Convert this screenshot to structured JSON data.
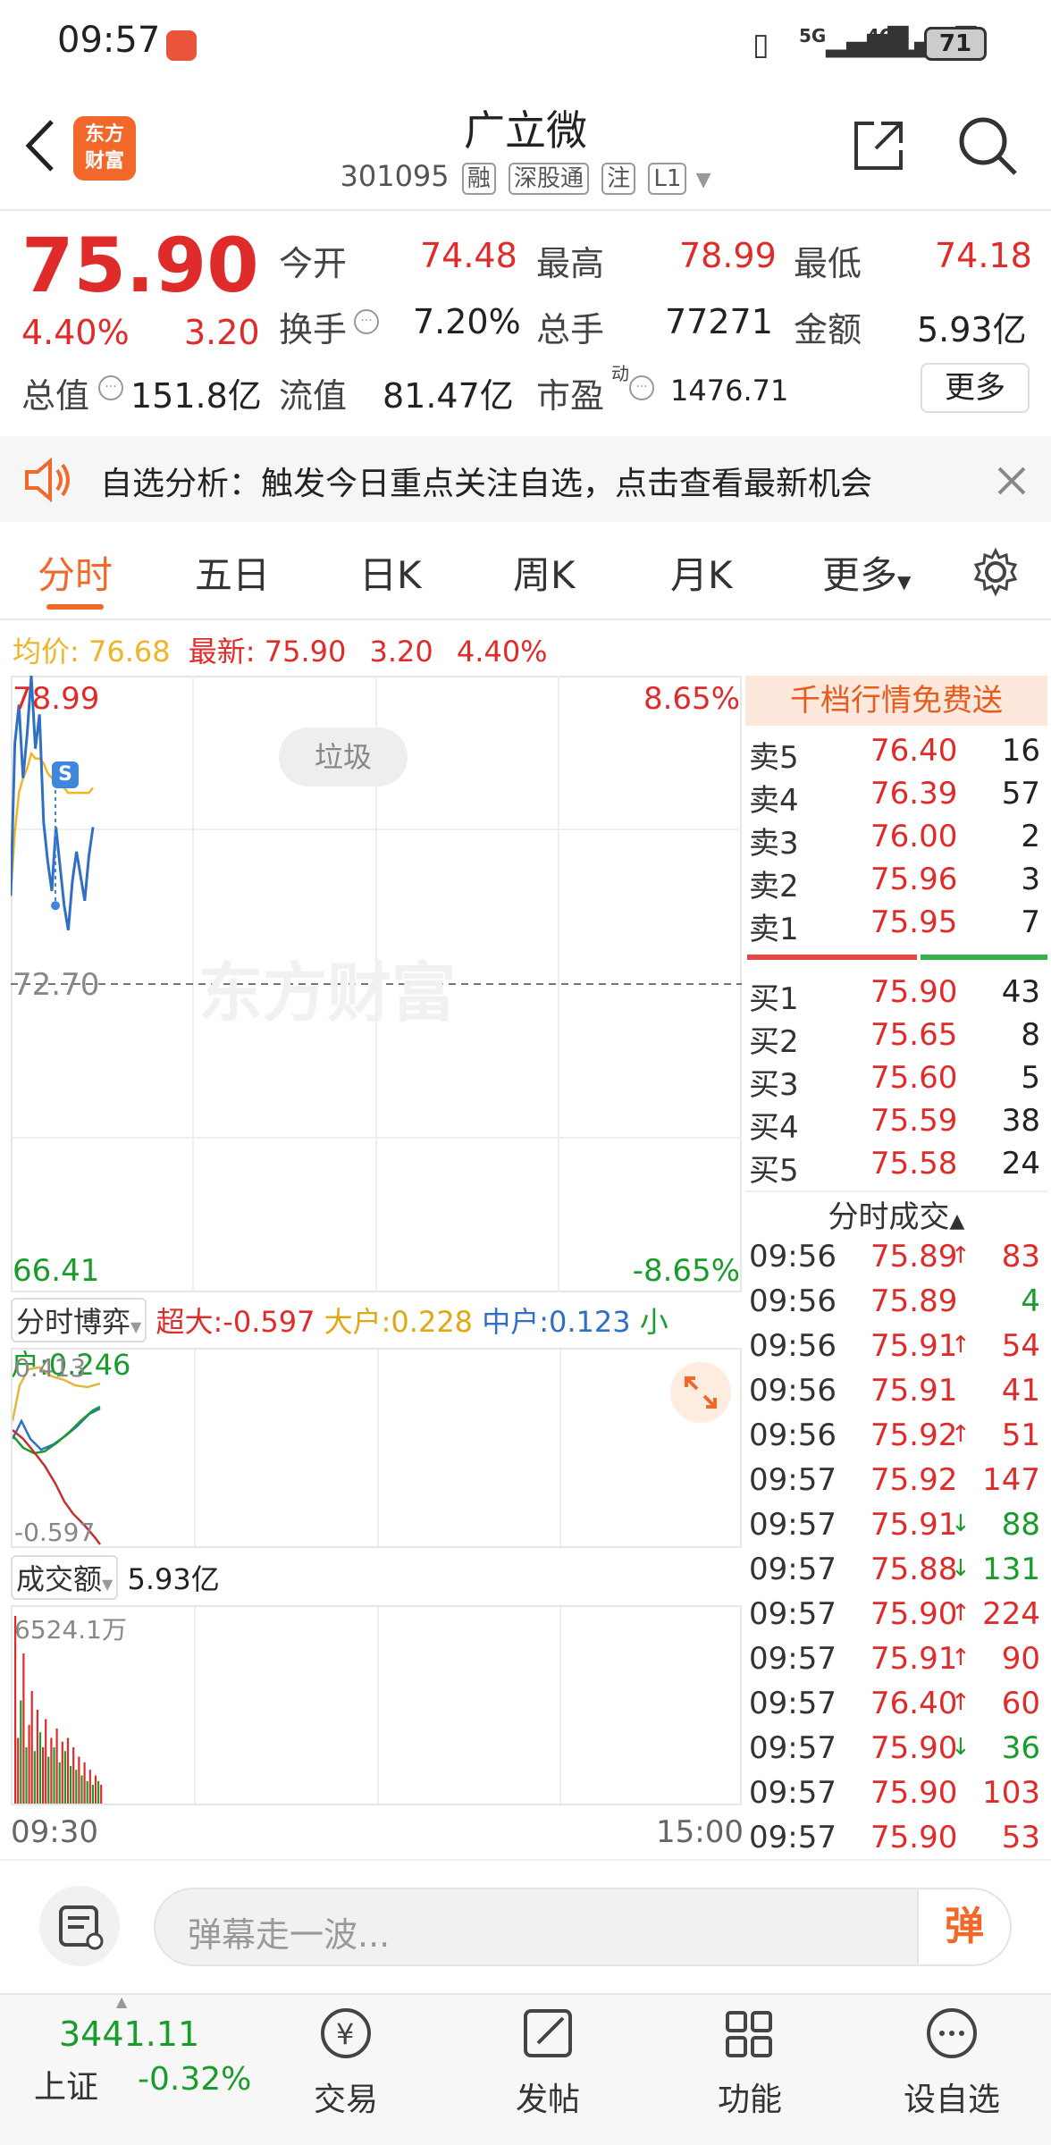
{
  "status": {
    "time": "09:57",
    "battery": "71",
    "net1": "5G",
    "net2": "4G"
  },
  "header": {
    "logo_line1": "东方",
    "logo_line2": "财富",
    "title": "广立微",
    "code": "301095",
    "tags": [
      "融",
      "深股通",
      "注",
      "L1"
    ]
  },
  "quote": {
    "price": "75.90",
    "change_pct": "4.40%",
    "change": "3.20",
    "open_label": "今开",
    "open": "74.48",
    "high_label": "最高",
    "high": "78.99",
    "low_label": "最低",
    "low": "74.18",
    "turnover_label": "换手",
    "turnover": "7.20%",
    "volume_label": "总手",
    "volume": "77271",
    "amount_label": "金额",
    "amount": "5.93亿",
    "mktcap_label": "总值",
    "mktcap": "151.8亿",
    "float_label": "流值",
    "float": "81.47亿",
    "pe_label": "市盈",
    "pe_sup": "动",
    "pe": "1476.71",
    "more_button": "更多"
  },
  "banner": {
    "text": "自选分析：触发今日重点关注自选，点击查看最新机会"
  },
  "tabs": [
    "分时",
    "五日",
    "日K",
    "周K",
    "月K",
    "更多"
  ],
  "info_line": {
    "avg_label": "均价:",
    "avg": "76.68",
    "latest_label": "最新:",
    "latest": "75.90",
    "change": "3.20",
    "change_pct": "4.40%"
  },
  "chart": {
    "max_price": "78.99",
    "max_pct": "8.65%",
    "prev_close": "72.70",
    "min_price": "66.41",
    "min_pct": "-8.65%",
    "tag_label": "垃圾",
    "watermark": "东方财富",
    "s_marker": "S",
    "time_start": "09:30",
    "time_end": "15:00"
  },
  "chart_data": {
    "type": "line",
    "ylim": [
      66.41,
      78.99
    ],
    "prev_close": 72.7,
    "price_series": [
      74.5,
      77.6,
      78.4,
      76.9,
      77.8,
      78.99,
      77.5,
      78.2,
      76.0,
      75.2,
      74.6,
      75.9,
      75.1,
      74.3,
      73.8,
      74.8,
      75.4,
      74.9,
      74.4,
      75.3,
      75.9
    ],
    "avg_series": [
      74.5,
      75.8,
      76.6,
      76.9,
      77.1,
      77.4,
      77.3,
      77.3,
      77.2,
      77.0,
      76.9,
      76.9,
      76.8,
      76.7,
      76.6,
      76.6,
      76.6,
      76.6,
      76.6,
      76.6,
      76.7
    ]
  },
  "game": {
    "selector": "分时博弈",
    "super_label": "超大:",
    "super": "-0.597",
    "big_label": "大户:",
    "big": "0.228",
    "mid_label": "中户:",
    "mid": "0.123",
    "small_label": "小户:",
    "small": "0.246",
    "top": "0.413",
    "bottom": "-0.597"
  },
  "vol": {
    "selector": "成交额",
    "total": "5.93亿",
    "max_label": "6524.1万",
    "bars": [
      1.0,
      0.35,
      0.55,
      0.8,
      0.3,
      0.42,
      0.6,
      0.28,
      0.5,
      0.38,
      0.3,
      0.45,
      0.25,
      0.35,
      0.3,
      0.4,
      0.22,
      0.33,
      0.28,
      0.35,
      0.2,
      0.3,
      0.18,
      0.25,
      0.15,
      0.22,
      0.12,
      0.18,
      0.1,
      0.15,
      0.12,
      0.1
    ],
    "bar_colors": [
      "r",
      "r",
      "g",
      "r",
      "g",
      "r",
      "r",
      "g",
      "r",
      "g",
      "r",
      "r",
      "g",
      "r",
      "g",
      "r",
      "g",
      "r",
      "g",
      "r",
      "g",
      "r",
      "g",
      "r",
      "g",
      "r",
      "g",
      "r",
      "g",
      "r",
      "g",
      "r"
    ]
  },
  "orderbook": {
    "title": "千档行情免费送",
    "asks": [
      {
        "label": "卖5",
        "price": "76.40",
        "qty": "16"
      },
      {
        "label": "卖4",
        "price": "76.39",
        "qty": "57"
      },
      {
        "label": "卖3",
        "price": "76.00",
        "qty": "2"
      },
      {
        "label": "卖2",
        "price": "75.96",
        "qty": "3"
      },
      {
        "label": "卖1",
        "price": "75.95",
        "qty": "7"
      }
    ],
    "bids": [
      {
        "label": "买1",
        "price": "75.90",
        "qty": "43"
      },
      {
        "label": "买2",
        "price": "75.65",
        "qty": "8"
      },
      {
        "label": "买3",
        "price": "75.60",
        "qty": "5"
      },
      {
        "label": "买4",
        "price": "75.59",
        "qty": "38"
      },
      {
        "label": "买5",
        "price": "75.58",
        "qty": "24"
      }
    ]
  },
  "trades": {
    "title": "分时成交",
    "rows": [
      {
        "time": "09:56",
        "price": "75.89",
        "arrow": "↑",
        "dir": "up",
        "qty": "83",
        "qc": "red"
      },
      {
        "time": "09:56",
        "price": "75.89",
        "arrow": "",
        "dir": "none",
        "qty": "4",
        "qc": "green"
      },
      {
        "time": "09:56",
        "price": "75.91",
        "arrow": "↑",
        "dir": "up",
        "qty": "54",
        "qc": "red"
      },
      {
        "time": "09:56",
        "price": "75.91",
        "arrow": "",
        "dir": "none",
        "qty": "41",
        "qc": "red"
      },
      {
        "time": "09:56",
        "price": "75.92",
        "arrow": "↑",
        "dir": "up",
        "qty": "51",
        "qc": "red"
      },
      {
        "time": "09:57",
        "price": "75.92",
        "arrow": "",
        "dir": "none",
        "qty": "147",
        "qc": "red"
      },
      {
        "time": "09:57",
        "price": "75.91",
        "arrow": "↓",
        "dir": "down",
        "qty": "88",
        "qc": "green"
      },
      {
        "time": "09:57",
        "price": "75.88",
        "arrow": "↓",
        "dir": "down",
        "qty": "131",
        "qc": "green"
      },
      {
        "time": "09:57",
        "price": "75.90",
        "arrow": "↑",
        "dir": "up",
        "qty": "224",
        "qc": "red"
      },
      {
        "time": "09:57",
        "price": "75.91",
        "arrow": "↑",
        "dir": "up",
        "qty": "90",
        "qc": "red"
      },
      {
        "time": "09:57",
        "price": "76.40",
        "arrow": "↑",
        "dir": "up",
        "qty": "60",
        "qc": "red"
      },
      {
        "time": "09:57",
        "price": "75.90",
        "arrow": "↓",
        "dir": "down",
        "qty": "36",
        "qc": "green"
      },
      {
        "time": "09:57",
        "price": "75.90",
        "arrow": "",
        "dir": "none",
        "qty": "103",
        "qc": "red"
      },
      {
        "time": "09:57",
        "price": "75.90",
        "arrow": "",
        "dir": "none",
        "qty": "53",
        "qc": "red"
      }
    ]
  },
  "comment": {
    "placeholder": "弹幕走一波...",
    "button": "弹"
  },
  "nav": {
    "index_value": "3441.11",
    "index_name": "上证",
    "index_change": "-0.32%",
    "items": [
      "交易",
      "发帖",
      "功能",
      "设自选"
    ]
  },
  "colors": {
    "up": "#e02b2b",
    "down": "#1a9c2c",
    "avg": "#f0b428",
    "price_line": "#2f6fc4",
    "accent": "#f2682a"
  }
}
